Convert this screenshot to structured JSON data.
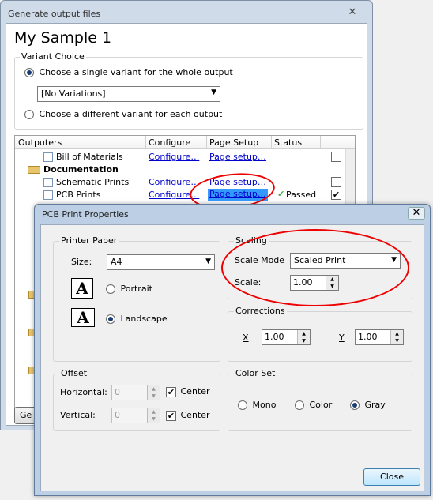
{
  "gen_window": {
    "title": "Generate output files",
    "close_glyph": "✕",
    "heading": "My Sample 1",
    "variant_group": "Variant Choice",
    "radio_single": "Choose a single variant for the whole output",
    "variant_combo_value": "[No Variations]",
    "radio_different": "Choose a different variant for each output",
    "grid_headers": [
      "Outputers",
      "Configure",
      "Page Setup",
      "Status"
    ],
    "rows": [
      {
        "name": "Bill of Materials",
        "configure": "Configure…",
        "page_setup": "Page setup…",
        "status": "",
        "checked": false
      },
      {
        "name": "Documentation",
        "folder": true
      },
      {
        "name": "Schematic Prints",
        "configure": "Configure…",
        "page_setup": "Page setup…",
        "status": "",
        "checked": false
      },
      {
        "name": "PCB Prints",
        "configure": "Configure…",
        "page_setup": "Page setup…",
        "status": "Passed",
        "checked": true
      }
    ],
    "generate_button_partial": "Ge"
  },
  "dialog": {
    "title": "PCB Print Properties",
    "close_glyph": "✕",
    "printer_paper": {
      "label": "Printer Paper",
      "size_label": "Size:",
      "size_value": "A4",
      "portrait": "Portrait",
      "landscape": "Landscape",
      "icon_letter": "A"
    },
    "scaling": {
      "label": "Scaling",
      "scale_mode_label": "Scale Mode",
      "scale_mode_value": "Scaled Print",
      "scale_label": "Scale:",
      "scale_value": "1.00"
    },
    "corrections": {
      "label": "Corrections",
      "x_label": "X",
      "x_value": "1.00",
      "y_label": "Y",
      "y_value": "1.00"
    },
    "offset": {
      "label": "Offset",
      "horizontal_label": "Horizontal:",
      "horizontal_value": "0",
      "vertical_label": "Vertical:",
      "vertical_value": "0",
      "center_label": "Center"
    },
    "color_set": {
      "label": "Color Set",
      "mono": "Mono",
      "color": "Color",
      "gray": "Gray",
      "selected": "Gray"
    },
    "close_button": "Close"
  },
  "colors": {
    "link": "#0000cc",
    "annotation": "#e00000",
    "passed_check": "#4caf50"
  }
}
